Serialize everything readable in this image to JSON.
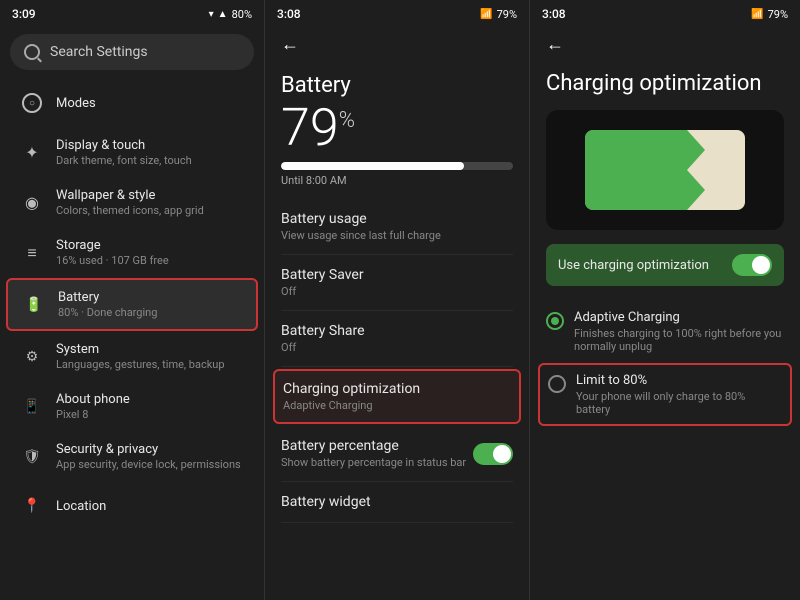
{
  "panel1": {
    "status": {
      "time": "3:09",
      "battery": "80%"
    },
    "search": {
      "placeholder": "Search Settings"
    },
    "items": [
      {
        "id": "modes",
        "icon": "⊙",
        "title": "Modes",
        "subtitle": ""
      },
      {
        "id": "display",
        "icon": "✦",
        "title": "Display & touch",
        "subtitle": "Dark theme, font size, touch"
      },
      {
        "id": "wallpaper",
        "icon": "◉",
        "title": "Wallpaper & style",
        "subtitle": "Colors, themed icons, app grid"
      },
      {
        "id": "storage",
        "icon": "≡",
        "title": "Storage",
        "subtitle": "16% used · 107 GB free"
      },
      {
        "id": "battery",
        "icon": "▮",
        "title": "Battery",
        "subtitle": "80% · Done charging",
        "active": true
      },
      {
        "id": "system",
        "icon": "⚙",
        "title": "System",
        "subtitle": "Languages, gestures, time, backup"
      },
      {
        "id": "about",
        "icon": "☎",
        "title": "About phone",
        "subtitle": "Pixel 8"
      },
      {
        "id": "security",
        "icon": "🛡",
        "title": "Security & privacy",
        "subtitle": "App security, device lock, permissions"
      },
      {
        "id": "location",
        "icon": "▾",
        "title": "Location",
        "subtitle": ""
      }
    ]
  },
  "panel2": {
    "status": {
      "time": "3:08",
      "battery": "79%"
    },
    "battery_percent": "79",
    "battery_symbol": "%",
    "battery_fill_width": "79%",
    "until": "Until 8:00 AM",
    "items": [
      {
        "id": "usage",
        "title": "Battery usage",
        "subtitle": "View usage since last full charge",
        "has_toggle": false,
        "highlighted": false
      },
      {
        "id": "saver",
        "title": "Battery Saver",
        "subtitle": "Off",
        "has_toggle": false,
        "highlighted": false
      },
      {
        "id": "share",
        "title": "Battery Share",
        "subtitle": "Off",
        "has_toggle": false,
        "highlighted": false
      },
      {
        "id": "optimization",
        "title": "Charging optimization",
        "subtitle": "Adaptive Charging",
        "has_toggle": false,
        "highlighted": true
      },
      {
        "id": "percentage",
        "title": "Battery percentage",
        "subtitle": "Show battery percentage in status bar",
        "has_toggle": true,
        "highlighted": false
      },
      {
        "id": "widget",
        "title": "Battery widget",
        "subtitle": "",
        "has_toggle": false,
        "highlighted": false
      }
    ]
  },
  "panel3": {
    "status": {
      "time": "3:08",
      "battery": "79%"
    },
    "title": "Charging optimization",
    "use_charging_label": "Use charging optimization",
    "options": [
      {
        "id": "adaptive",
        "title": "Adaptive Charging",
        "subtitle": "Finishes charging to 100% right before you normally unplug",
        "selected": true,
        "highlighted": false
      },
      {
        "id": "limit80",
        "title": "Limit to 80%",
        "subtitle": "Your phone will only charge to 80% battery",
        "selected": false,
        "highlighted": true
      }
    ]
  }
}
